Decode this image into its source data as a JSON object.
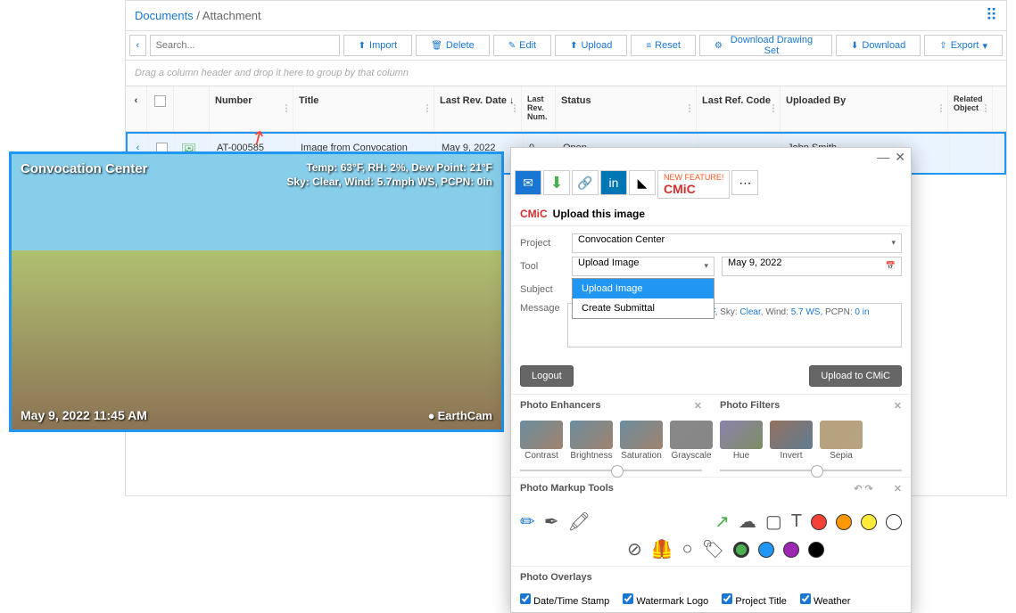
{
  "breadcrumb": {
    "root": "Documents",
    "current": "Attachment"
  },
  "toolbar": {
    "search_placeholder": "Search...",
    "import": "Import",
    "delete": "Delete",
    "edit": "Edit",
    "upload": "Upload",
    "reset": "Reset",
    "download_set": "Download Drawing Set",
    "download": "Download",
    "export": "Export"
  },
  "group_bar": "Drag a column header and drop it here to group by that column",
  "grid": {
    "headers": {
      "number": "Number",
      "title": "Title",
      "last_rev_date": "Last Rev. Date",
      "last_rev_num": "Last Rev. Num.",
      "status": "Status",
      "last_ref_code": "Last Ref. Code",
      "uploaded_by": "Uploaded By",
      "related_object": "Related Object"
    },
    "row": {
      "number": "AT-000585",
      "title": "Image from Convocation Center",
      "last_rev_date": "May 9, 2022",
      "last_rev_num": "0",
      "status": "Open",
      "last_ref_code": "",
      "uploaded_by": "John Smith"
    }
  },
  "camera": {
    "title": "Convocation Center",
    "weather_line1": "Temp: 63°F, RH: 2%, Dew Point: 21°F",
    "weather_line2": "Sky: Clear, Wind: 5.7mph WS, PCPN: 0in",
    "timestamp": "May 9, 2022 11:45 AM",
    "logo": "EarthCam"
  },
  "dialog": {
    "brand": "CMiC",
    "new_feature": "NEW FEATURE!",
    "title": "Upload this image",
    "labels": {
      "project": "Project",
      "tool": "Tool",
      "subject": "Subject",
      "message": "Message"
    },
    "project_value": "Convocation Center",
    "tool_value": "Upload Image",
    "date_value": "May 9, 2022",
    "dropdown": {
      "opt1": "Upload Image",
      "opt2": "Create Submittal"
    },
    "message_text": {
      "p1": "Temp: ",
      "v1": "63F",
      "p2": ", RH: ",
      "v2": "2%",
      "p3": ", Dew Point: ",
      "v3": "21F",
      "p4": ", Sky: ",
      "v4": "Clear",
      "p5": ", Wind: ",
      "v5": "5.7 WS",
      "p6": ", PCPN: ",
      "v6": "0 in"
    },
    "logout": "Logout",
    "upload_btn": "Upload to CMiC",
    "enhancers_hdr": "Photo Enhancers",
    "filters_hdr": "Photo Filters",
    "enhancers": [
      "Contrast",
      "Brightness",
      "Saturation"
    ],
    "filters": [
      "Grayscale",
      "Hue",
      "Invert",
      "Sepia"
    ],
    "markup_hdr": "Photo Markup Tools",
    "overlays_hdr": "Photo Overlays",
    "overlay_opts": {
      "datetime": "Date/Time Stamp",
      "watermark": "Watermark Logo",
      "project": "Project Title",
      "weather": "Weather"
    },
    "colors": [
      "#f44336",
      "#ff9800",
      "#ffeb3b",
      "#ffffff",
      "#4caf50",
      "#2196f3",
      "#9c27b0",
      "#000000"
    ]
  }
}
